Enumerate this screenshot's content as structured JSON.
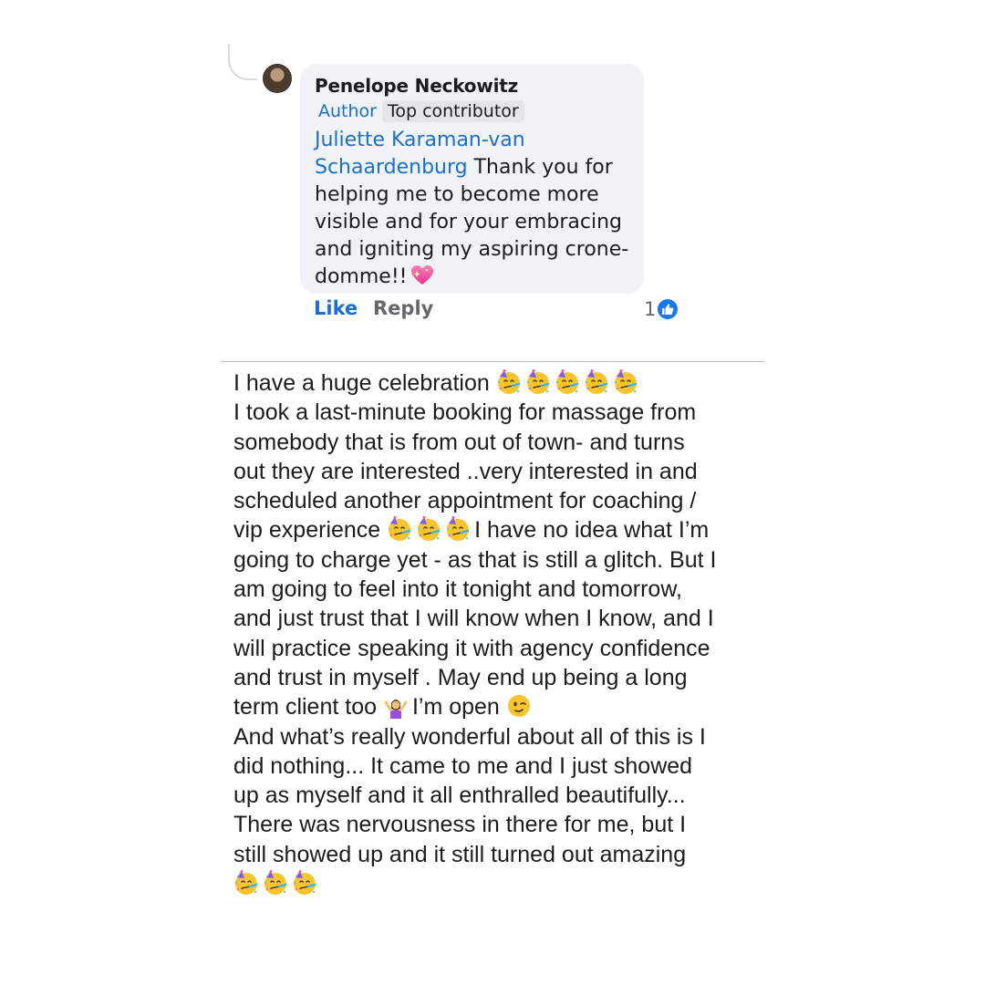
{
  "comment": {
    "author_name": "Penelope Neckowitz",
    "badge_author": "Author",
    "badge_top": "Top contributor",
    "mention": "Juliette Karaman-van Schaardenburg",
    "lines": [
      {
        "mention": "Juliette Karaman-van",
        "text": ""
      },
      {
        "mention": "Schaardenburg",
        "text": " Thank you for"
      },
      {
        "mention": "",
        "text": "helping me to become more"
      },
      {
        "mention": "",
        "text": "visible and for your embracing"
      },
      {
        "mention": "",
        "text": "and igniting my aspiring crone-"
      },
      {
        "mention": "",
        "text": "domme!!"
      }
    ],
    "trailing_icon": "sparkling-heart-icon",
    "actions": {
      "like_label": "Like",
      "reply_label": "Reply",
      "reaction_count": "1",
      "reaction_icon": "like-thumbs-up-icon"
    },
    "colors": {
      "link_blue": "#1a6fd0",
      "bubble_bg": "#f0f2f5",
      "muted_gray": "#65676b"
    }
  },
  "post": {
    "lines": [
      {
        "text": "I have a huge celebration ",
        "emoji_after": 5,
        "emoji_before": 0
      },
      {
        "text": "I took a last-minute booking for massage  from",
        "emoji_after": 0,
        "emoji_before": 0
      },
      {
        "text": "somebody that is from out of town- and turns",
        "emoji_after": 0,
        "emoji_before": 0
      },
      {
        "text": "out they are interested    ..very interested in and",
        "emoji_after": 0,
        "emoji_before": 0
      },
      {
        "text": "scheduled another appointment for coaching /",
        "emoji_after": 0,
        "emoji_before": 0
      },
      {
        "text": "vip experience ",
        "emoji_after": 3,
        "emoji_before": 0,
        "tail": "I have no idea what I’m"
      },
      {
        "text": "going to charge yet - as that is still a glitch. But I",
        "emoji_after": 0,
        "emoji_before": 0
      },
      {
        "text": "am going to feel into it tonight and tomorrow,",
        "emoji_after": 0,
        "emoji_before": 0
      },
      {
        "text": "and just trust that I will know when I know, and I",
        "emoji_after": 0,
        "emoji_before": 0
      },
      {
        "text": "will practice speaking it with agency confidence",
        "emoji_after": 0,
        "emoji_before": 0
      },
      {
        "text": "and trust in myself . May end up being a long",
        "emoji_after": 0,
        "emoji_before": 0
      },
      {
        "text": "term client too ",
        "emoji_after": 0,
        "emoji_before": 0,
        "special": "shrug-wink",
        "tail_a": "I’m open "
      },
      {
        "text": "And what’s really wonderful about all of this is I",
        "emoji_after": 0,
        "emoji_before": 0
      },
      {
        "text": "did nothing... It came to me and I just showed",
        "emoji_after": 0,
        "emoji_before": 0
      },
      {
        "text": "up as myself and it all enthralled beautifully...",
        "emoji_after": 0,
        "emoji_before": 0
      },
      {
        "text": "There was nervousness in there for me, but I",
        "emoji_after": 0,
        "emoji_before": 0
      },
      {
        "text": "still showed up and it still turned out amazing",
        "emoji_after": 0,
        "emoji_before": 0
      },
      {
        "text": "",
        "emoji_after": 3,
        "emoji_before": 0
      }
    ],
    "icons": {
      "party": "partying-face-icon",
      "shrug": "woman-raising-hands-icon",
      "wink": "winking-face-icon"
    }
  }
}
